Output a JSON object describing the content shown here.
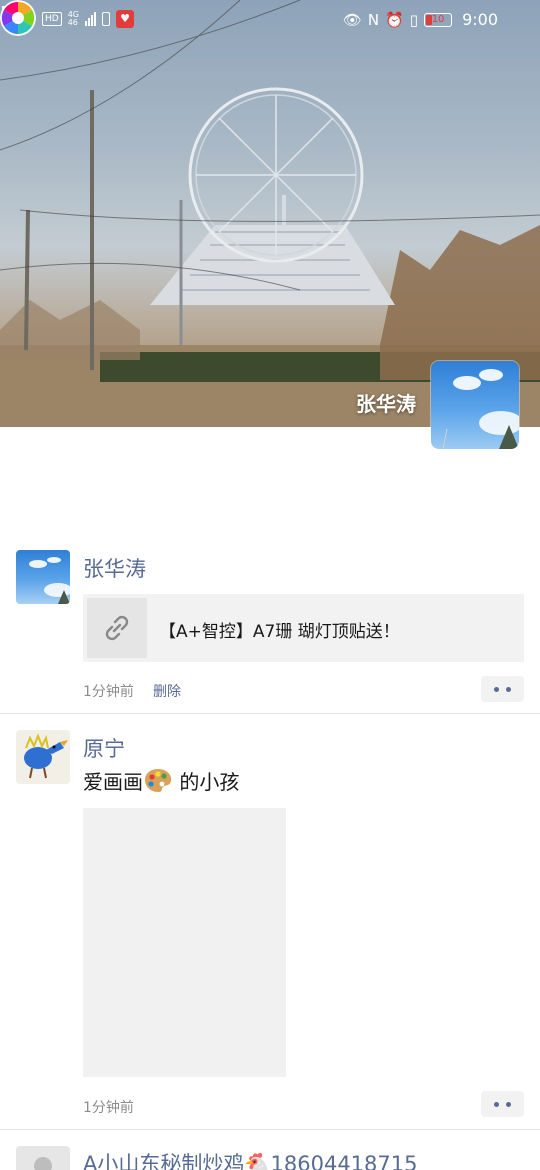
{
  "status_bar": {
    "hd": "HD",
    "network_top": "4G",
    "network_bottom": "46",
    "battery_level": "10",
    "time": "9:00"
  },
  "cover": {
    "owner_name": "张华涛"
  },
  "posts": [
    {
      "author": "张华涛",
      "link_title": "【A+智控】A7珊 瑚灯顶贴送！",
      "time": "1分钟前",
      "delete_label": "删除"
    },
    {
      "author": "原宁",
      "text_before": "爱画画",
      "text_after": " 的小孩",
      "time": "1分钟前"
    },
    {
      "author": "A小山东秘制炒鸡🐔18604418715"
    }
  ],
  "icons": {
    "back": "chevron-left-icon",
    "camera": "camera-icon",
    "link": "link-icon",
    "more": "more-dots-icon"
  }
}
